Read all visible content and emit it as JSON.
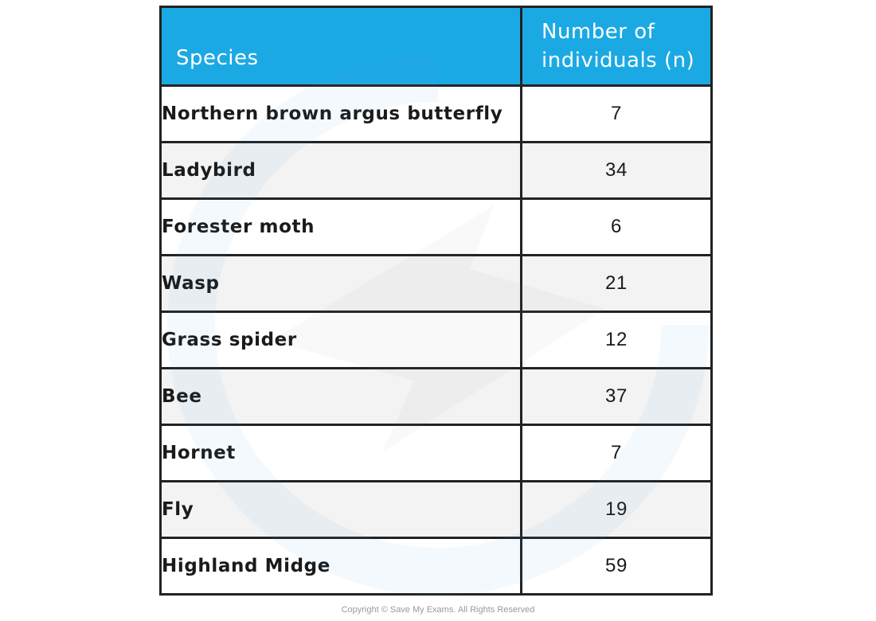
{
  "table": {
    "headers": {
      "species": "Species",
      "count_line1": "Number of",
      "count_line2": "individuals (n)"
    },
    "rows": [
      {
        "species": "Northern  brown argus butterfly",
        "count": "7"
      },
      {
        "species": "Ladybird",
        "count": "34"
      },
      {
        "species": "Forester moth",
        "count": "6"
      },
      {
        "species": "Wasp",
        "count": "21"
      },
      {
        "species": "Grass spider",
        "count": "12"
      },
      {
        "species": "Bee",
        "count": "37"
      },
      {
        "species": "Hornet",
        "count": "7"
      },
      {
        "species": "Fly",
        "count": "19"
      },
      {
        "species": "Highland Midge",
        "count": "59"
      }
    ]
  },
  "colors": {
    "header_background": "#1ba9e4",
    "header_text": "#ffffff",
    "border": "#222222",
    "alt_row": "#f3f3f3"
  },
  "footer": {
    "copyright": "Copyright © Save My Exams. All Rights Reserved"
  }
}
